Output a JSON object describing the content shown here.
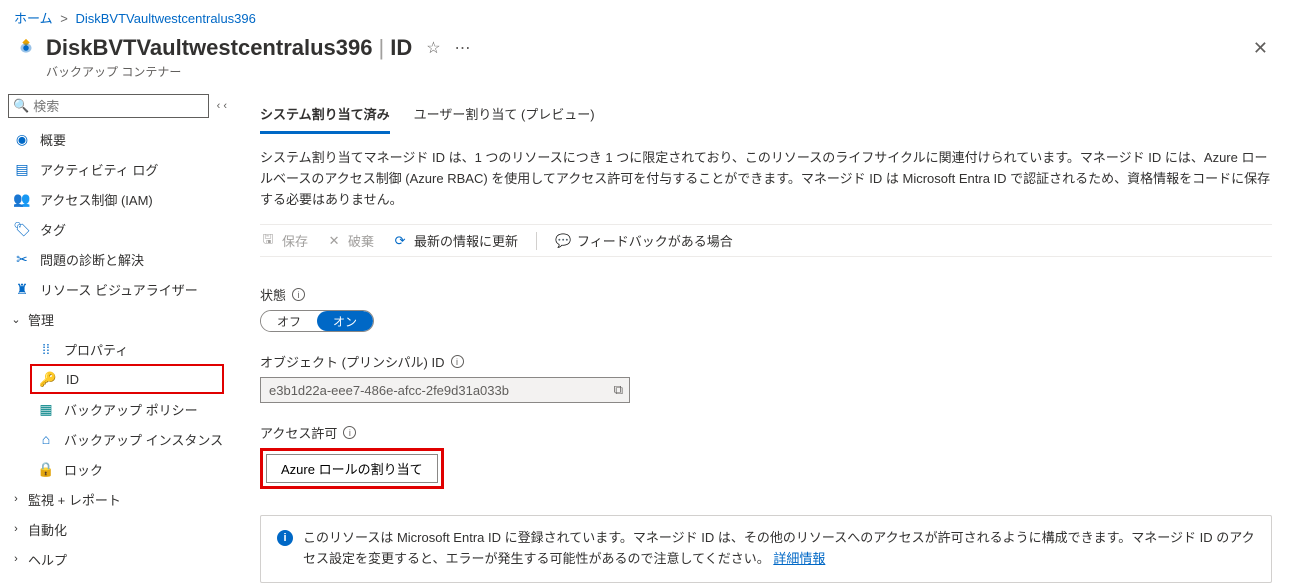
{
  "breadcrumb": {
    "home": "ホーム",
    "resource": "DiskBVTVaultwestcentralus396"
  },
  "title": {
    "resource": "DiskBVTVaultwestcentralus396",
    "blade": "ID",
    "subtitle": "バックアップ コンテナー"
  },
  "search": {
    "placeholder": "検索"
  },
  "nav": {
    "overview": "概要",
    "activity": "アクティビティ ログ",
    "iam": "アクセス制御 (IAM)",
    "tags": "タグ",
    "diag": "問題の診断と解決",
    "resvis": "リソース ビジュアライザー",
    "group_manage": "管理",
    "properties": "プロパティ",
    "id": "ID",
    "policy": "バックアップ ポリシー",
    "instance": "バックアップ インスタンス",
    "lock": "ロック",
    "group_monitor": "監視 + レポート",
    "group_automation": "自動化",
    "group_help": "ヘルプ"
  },
  "tabs": {
    "system": "システム割り当て済み",
    "user": "ユーザー割り当て (プレビュー)"
  },
  "description": "システム割り当てマネージド ID は、1 つのリソースにつき 1 つに限定されており、このリソースのライフサイクルに関連付けられています。マネージド ID には、Azure ロールベースのアクセス制御 (Azure RBAC) を使用してアクセス許可を付与することができます。マネージド ID は Microsoft Entra ID で認証されるため、資格情報をコードに保存する必要はありません。",
  "toolbar": {
    "save": "保存",
    "discard": "破棄",
    "refresh": "最新の情報に更新",
    "feedback": "フィードバックがある場合"
  },
  "form": {
    "status_label": "状態",
    "off": "オフ",
    "on": "オン",
    "object_label": "オブジェクト (プリンシパル) ID",
    "object_value": "e3b1d22a-eee7-486e-afcc-2fe9d31a033b",
    "perm_label": "アクセス許可",
    "role_button": "Azure ロールの割り当て"
  },
  "banner": {
    "text": "このリソースは Microsoft Entra ID に登録されています。マネージド ID は、その他のリソースへのアクセスが許可されるように構成できます。マネージド ID のアクセス設定を変更すると、エラーが発生する可能性があるので注意してください。",
    "link": "詳細情報"
  }
}
